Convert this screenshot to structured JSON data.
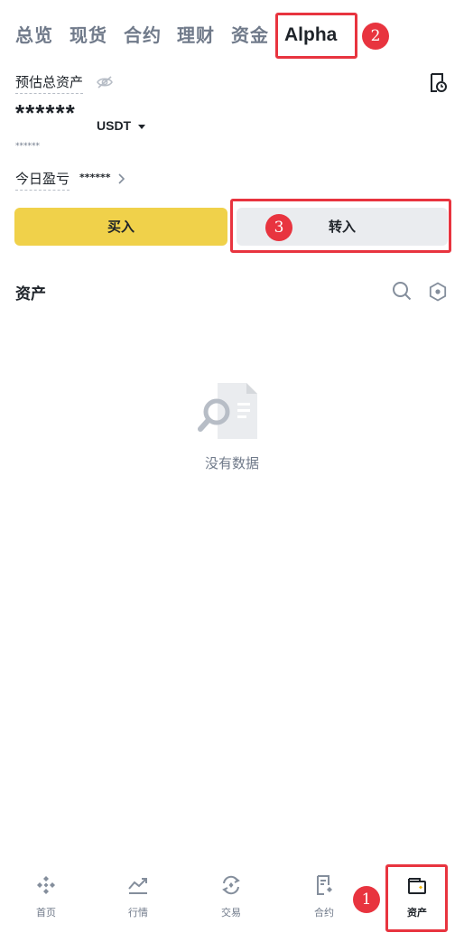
{
  "tabs": [
    "总览",
    "现货",
    "合约",
    "理财",
    "资金",
    "Alpha"
  ],
  "annotations": {
    "badge_1": "1",
    "badge_2": "2",
    "badge_3": "3"
  },
  "balance": {
    "label": "预估总资产",
    "masked_value": "******",
    "currency": "USDT",
    "masked_secondary": "******"
  },
  "pnl": {
    "label": "今日盈亏",
    "masked_value": "******"
  },
  "actions": {
    "buy_label": "买入",
    "transfer_label": "转入"
  },
  "assets": {
    "title": "资产",
    "empty_text": "没有数据"
  },
  "bottom_nav": [
    {
      "label": "首页",
      "icon": "binance-logo-icon"
    },
    {
      "label": "行情",
      "icon": "market-chart-icon"
    },
    {
      "label": "交易",
      "icon": "trade-exchange-icon"
    },
    {
      "label": "合约",
      "icon": "futures-doc-icon"
    },
    {
      "label": "资产",
      "icon": "wallet-icon",
      "active": true
    }
  ],
  "colors": {
    "accent_yellow": "#f0d14a",
    "highlight_red": "#e8343f",
    "text_primary": "#1e2329",
    "text_secondary": "#707a8a",
    "button_grey": "#eaecef"
  }
}
